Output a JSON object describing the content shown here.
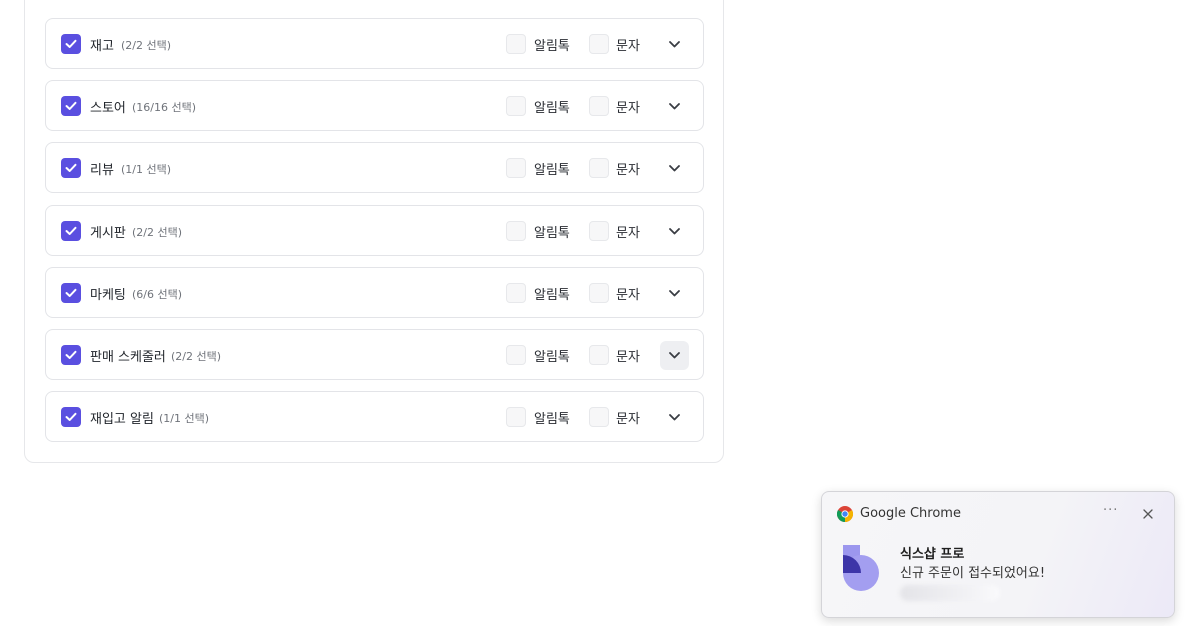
{
  "categories": [
    {
      "label": "재고",
      "count": "(2/2 선택)"
    },
    {
      "label": "스토어",
      "count": "(16/16 선택)"
    },
    {
      "label": "리뷰",
      "count": "(1/1 선택)"
    },
    {
      "label": "게시판",
      "count": "(2/2 선택)"
    },
    {
      "label": "마케팅",
      "count": "(6/6 선택)"
    },
    {
      "label": "판매 스케줄러",
      "count": "(2/2 선택)"
    },
    {
      "label": "재입고 알림",
      "count": "(1/1 선택)"
    }
  ],
  "channels": {
    "alimtalk": "알림톡",
    "sms": "문자"
  },
  "colors": {
    "accent": "#5a4fe0"
  },
  "notification": {
    "app": "Google Chrome",
    "more": "···",
    "title": "식스샵 프로",
    "body": "신규 주문이 접수되었어요!"
  }
}
